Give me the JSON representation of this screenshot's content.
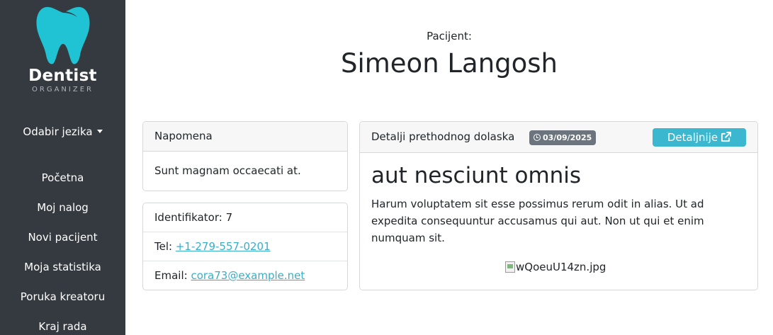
{
  "sidebar": {
    "logo_title": "Dentist",
    "logo_subtitle": "ORGANIZER",
    "language_label": "Odabir jezika",
    "nav": [
      {
        "label": "Početna"
      },
      {
        "label": "Moj nalog"
      },
      {
        "label": "Novi pacijent"
      },
      {
        "label": "Moja statistika"
      },
      {
        "label": "Poruka kreatoru"
      },
      {
        "label": "Kraj rada"
      }
    ]
  },
  "patient": {
    "label": "Pacijent:",
    "name": "Simeon Langosh"
  },
  "note": {
    "header": "Napomena",
    "text": "Sunt magnam occaecati at."
  },
  "info": {
    "id_text": "Identifikator: 7",
    "tel_label": "Tel: ",
    "tel_value": "+1-279-557-0201",
    "email_label": "Email: ",
    "email_value": "cora73@example.net"
  },
  "visit": {
    "header": "Detalji prethodnog dolaska",
    "date": "03/09/2025",
    "details_button": "Detaljnije",
    "title": "aut nesciunt omnis",
    "text": "Harum voluptatem sit esse possimus rerum odit in alias. Ut ad expedita consequuntur accusamus qui aut. Non ut qui et enim numquam sit.",
    "image_alt": "wQoeuU14zn.jpg"
  },
  "colors": {
    "sidebar_bg": "#343a40",
    "logo_tooth": "#1fc3d3",
    "accent": "#3bb8cf",
    "badge_bg": "#6c757d",
    "link": "#3aaec8"
  },
  "icons": {
    "logo": "tooth-icon",
    "language_caret": "caret-down-icon",
    "date": "clock-icon",
    "details": "external-link-icon",
    "image": "broken-image-icon"
  }
}
